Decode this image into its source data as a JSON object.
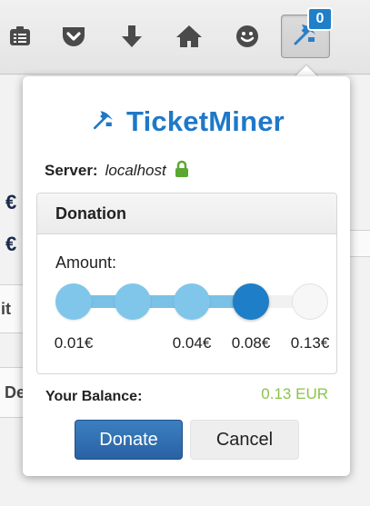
{
  "toolbar": {
    "icons": [
      "reading-list-icon",
      "pocket-icon",
      "download-icon",
      "home-icon",
      "smiley-icon"
    ],
    "extension_icon": "pickaxe-icon",
    "badge_count": "0"
  },
  "background": {
    "fragments": [
      "€",
      "€",
      "it",
      "De"
    ]
  },
  "popup": {
    "brand": "TicketMiner",
    "server_label": "Server:",
    "server_value": "localhost",
    "panel_title": "Donation",
    "amount_label": "Amount:",
    "amount_options": [
      "0.01€",
      "0.04€",
      "0.08€",
      "0.13€"
    ],
    "slider_positions": [
      "0.01€",
      "0.02€",
      "0.04€",
      "0.08€",
      "0.13€"
    ],
    "selected_amount": "0.08€",
    "balance_label": "Your Balance:",
    "balance_value": "0.13 EUR",
    "donate_label": "Donate",
    "cancel_label": "Cancel"
  },
  "colors": {
    "brand": "#1f78c8",
    "slider_filled": "#80c6ea",
    "slider_current": "#1e7ec7",
    "balance": "#8bc34a",
    "donate_button": "#2f6fb2"
  }
}
